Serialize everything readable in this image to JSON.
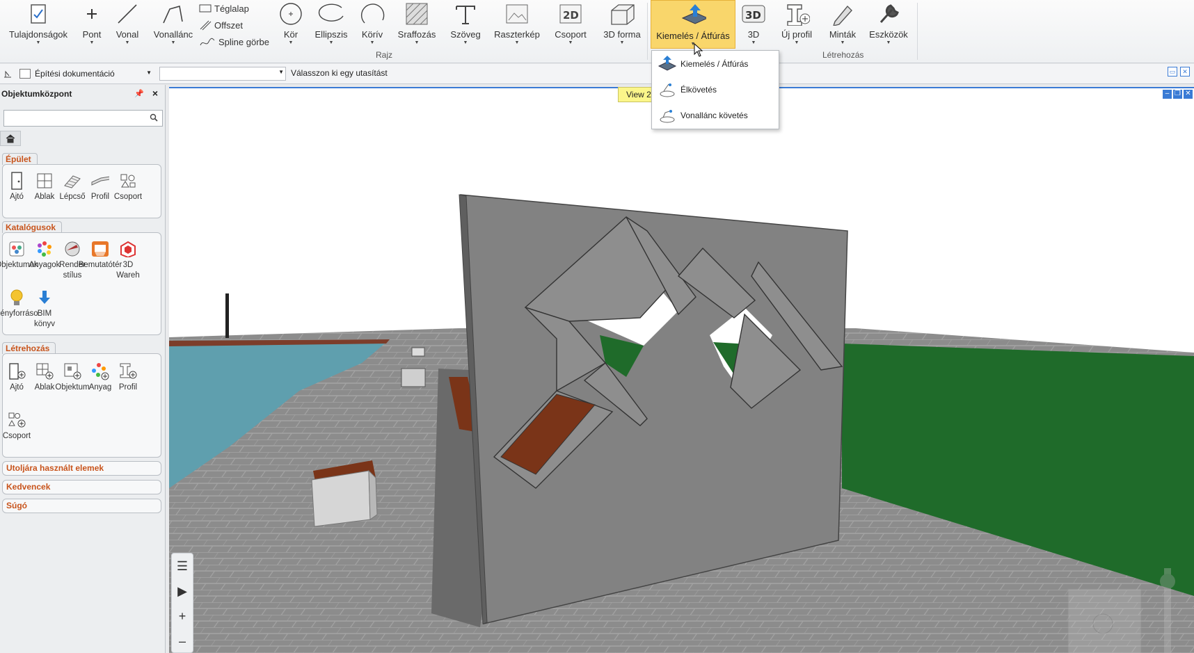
{
  "ribbon": {
    "buttons": [
      {
        "id": "properties",
        "label": "Tulajdonságok",
        "icon": "properties-icon"
      },
      {
        "id": "point",
        "label": "Pont",
        "icon": "point-icon"
      },
      {
        "id": "line",
        "label": "Vonal",
        "icon": "line-icon"
      },
      {
        "id": "polyline",
        "label": "Vonallánc",
        "icon": "polyline-icon"
      },
      {
        "id": "circle",
        "label": "Kör",
        "icon": "circle-icon"
      },
      {
        "id": "ellipse",
        "label": "Ellipszis",
        "icon": "ellipse-icon"
      },
      {
        "id": "arc",
        "label": "Körív",
        "icon": "arc-icon"
      },
      {
        "id": "hatch",
        "label": "Sraffozás",
        "icon": "hatch-icon"
      },
      {
        "id": "text",
        "label": "Szöveg",
        "icon": "text-icon"
      },
      {
        "id": "raster",
        "label": "Raszterkép",
        "icon": "raster-icon"
      },
      {
        "id": "group2d",
        "label": "Csoport",
        "icon": "group-2d-icon"
      },
      {
        "id": "shape3d",
        "label": "3D forma",
        "icon": "shape-3d-icon"
      },
      {
        "id": "extrude",
        "label": "Kiemelés / Átfúrás",
        "icon": "extrude-icon"
      },
      {
        "id": "view3d",
        "label": "3D",
        "icon": "view-3d-icon"
      },
      {
        "id": "newprofile",
        "label": "Új profil",
        "icon": "new-profile-icon"
      },
      {
        "id": "patterns",
        "label": "Minták",
        "icon": "patterns-icon"
      },
      {
        "id": "tools",
        "label": "Eszközök",
        "icon": "tools-icon"
      }
    ],
    "small": [
      "Téglalap",
      "Offszet",
      "Spline görbe"
    ],
    "groups": {
      "draw": "Rajz",
      "create": "Létrehozás"
    }
  },
  "dropdown": {
    "items": [
      {
        "label": "Kiemelés / Átfúrás",
        "icon": "extrude-icon"
      },
      {
        "label": "Élkövetés",
        "icon": "edge-follow-icon"
      },
      {
        "label": "Vonallánc követés",
        "icon": "polyline-follow-icon"
      }
    ]
  },
  "cmdbar": {
    "layout": "Építési dokumentáció",
    "input_value": "",
    "prompt": "Válasszon ki egy utasítást"
  },
  "panel": {
    "title": "Objektumközpont",
    "search_placeholder": "",
    "sections": {
      "building": {
        "title": "Épület",
        "tools": [
          "Ajtó",
          "Ablak",
          "Lépcső",
          "Profil",
          "Csoport"
        ]
      },
      "catalogs": {
        "title": "Katalógusok",
        "tools": [
          "Objektumok",
          "Anyagok",
          "Render stílus",
          "Bemutatótér",
          "3D Wareh",
          "Fényforráso",
          "BIM könyv"
        ]
      },
      "create": {
        "title": "Létrehozás",
        "tools": [
          "Ajtó",
          "Ablak",
          "Objektum",
          "Anyag",
          "Profil",
          "Csoport"
        ]
      }
    },
    "collapsed": [
      "Utoljára használt elemek",
      "Kedvencek",
      "Súgó"
    ]
  },
  "viewport": {
    "tab_label": "View 2",
    "colors": {
      "sky": "#ffffff",
      "wall": "#808080",
      "grass": "#1f6b2a",
      "water": "#6aaab8",
      "paving": "#8a8a8a",
      "wood": "#7a3418"
    }
  }
}
